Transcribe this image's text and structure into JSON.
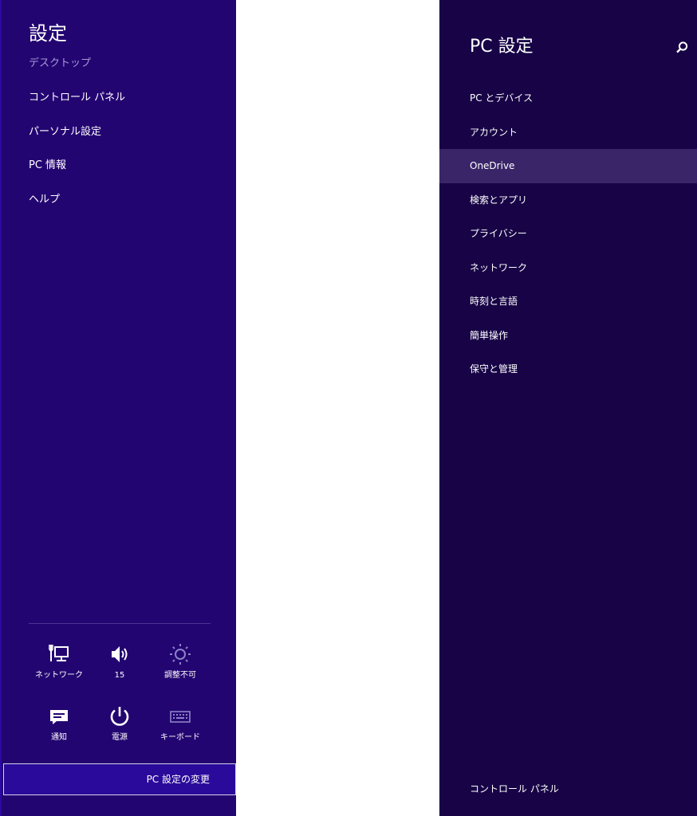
{
  "settings_charm": {
    "title": "設定",
    "subtitle": "デスクトップ",
    "items": [
      {
        "label": "コントロール パネル"
      },
      {
        "label": "パーソナル設定"
      },
      {
        "label": "PC 情報"
      },
      {
        "label": "ヘルプ"
      }
    ],
    "tiles": [
      {
        "label": "ネットワーク",
        "icon": "network-icon"
      },
      {
        "label": "15",
        "icon": "volume-icon"
      },
      {
        "label": "調整不可",
        "icon": "brightness-icon"
      },
      {
        "label": "通知",
        "icon": "notifications-icon"
      },
      {
        "label": "電源",
        "icon": "power-icon"
      },
      {
        "label": "キーボード",
        "icon": "keyboard-icon"
      }
    ],
    "change_button": "PC 設定の変更"
  },
  "pc_settings": {
    "title": "PC 設定",
    "search_icon": "search-icon",
    "items": [
      {
        "label": "PC とデバイス"
      },
      {
        "label": "アカウント"
      },
      {
        "label": "OneDrive"
      },
      {
        "label": "検索とアプリ"
      },
      {
        "label": "プライバシー"
      },
      {
        "label": "ネットワーク"
      },
      {
        "label": "時刻と言語"
      },
      {
        "label": "簡単操作"
      },
      {
        "label": "保守と管理"
      }
    ],
    "selected_item": "OneDrive",
    "footer_link": "コントロール パネル"
  },
  "colors": {
    "charm_background": "#230571",
    "panel_background": "#170346",
    "selected_item": "#3a2569",
    "button_background": "#2a0a9a"
  }
}
